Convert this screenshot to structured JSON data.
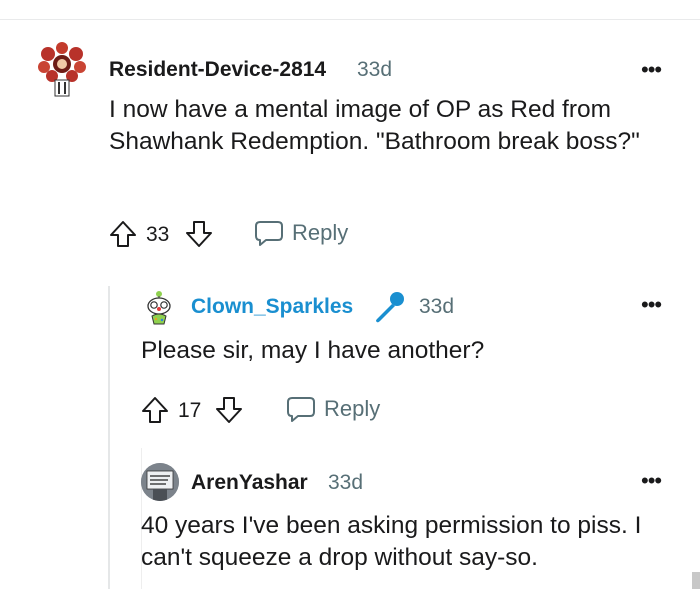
{
  "comments": [
    {
      "username": "Resident-Device-2814",
      "age": "33d",
      "text": "I now have a mental image of OP as Red from Shawhank Redemption. \"Bathroom break boss?\"",
      "votes": "33",
      "reply_label": "Reply",
      "more_label": "•••"
    },
    {
      "username": "Clown_Sparkles",
      "age": "33d",
      "text": "Please sir, may I have another?",
      "votes": "17",
      "reply_label": "Reply",
      "more_label": "•••",
      "username_color": "#1a8fd0",
      "badge_icon": "microphone-icon"
    },
    {
      "username": "ArenYashar",
      "age": "33d",
      "text": "40 years I've been asking permission to piss. I can't squeeze a drop without say-so.",
      "more_label": "•••",
      "avatar_sign_text": "HELP ME\nGRAB A MASK\nLOOK UP"
    }
  ],
  "colors": {
    "text": "#1a1a1b",
    "meta": "#576f76",
    "accent": "#1a8fd0"
  }
}
